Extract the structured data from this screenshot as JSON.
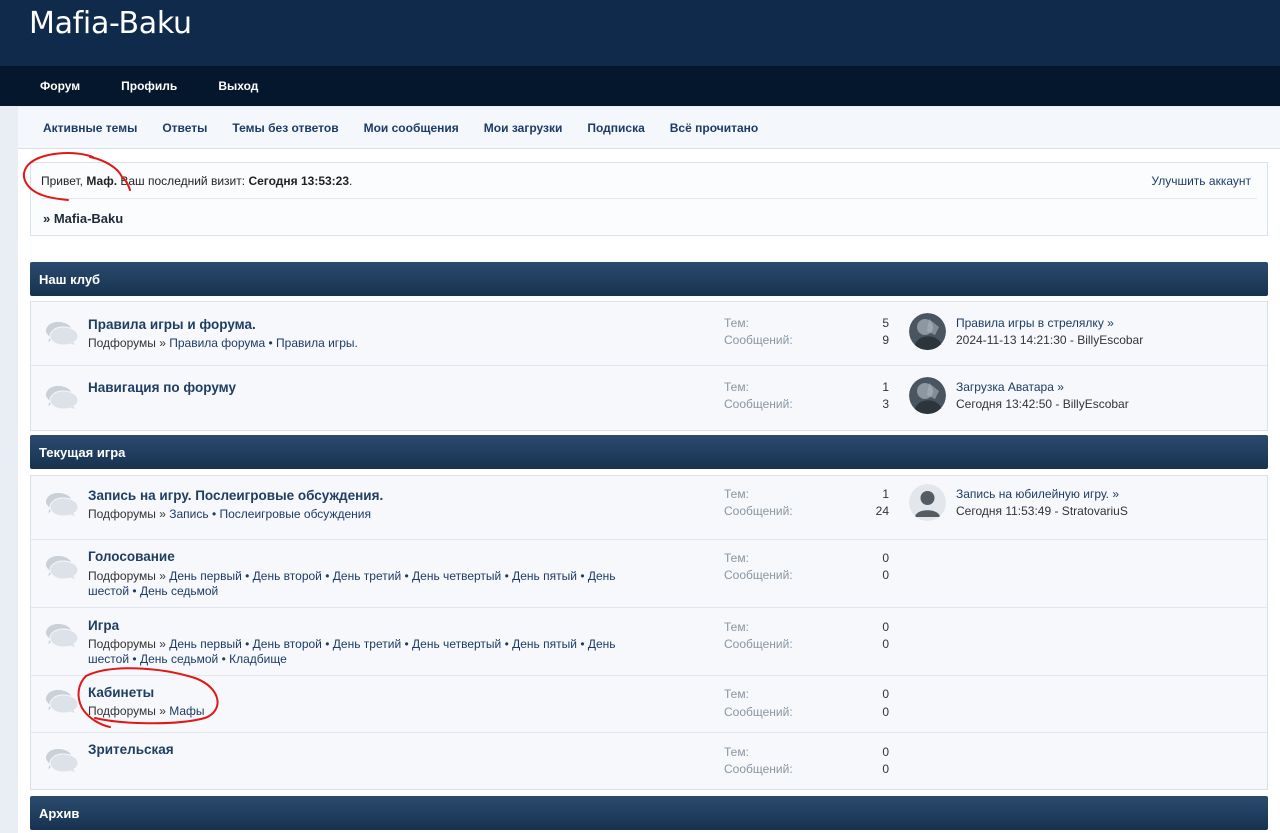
{
  "site": {
    "title": "Mafia-Baku"
  },
  "main_nav": [
    {
      "label": "Форум"
    },
    {
      "label": "Профиль"
    },
    {
      "label": "Выход"
    }
  ],
  "sub_nav": [
    {
      "label": "Активные темы"
    },
    {
      "label": "Ответы"
    },
    {
      "label": "Темы без ответов"
    },
    {
      "label": "Мои сообщения"
    },
    {
      "label": "Мои загрузки"
    },
    {
      "label": "Подписка"
    },
    {
      "label": "Всё прочитано"
    }
  ],
  "welcome": {
    "greeting": "Привет,",
    "username": "Маф.",
    "last_visit_label": "Ваш последний визит:",
    "last_visit_value": "Сегодня 13:53:23",
    "last_visit_suffix": ".",
    "upgrade_link": "Улучшить аккаунт",
    "breadcrumb": "» Mafia-Baku"
  },
  "labels": {
    "topics": "Тем:",
    "posts": "Сообщений:",
    "subforums": "Подфорумы »",
    "bullet": "•"
  },
  "categories": [
    {
      "title": "Наш клуб",
      "forums": [
        {
          "title": "Правила игры и форума.",
          "subforums": [
            "Правила форума",
            "Правила игры."
          ],
          "topics": "5",
          "posts": "9",
          "last_post": {
            "title": "Правила игры в стрелялку »",
            "meta": "2024-11-13 14:21:30 - BillyEscobar",
            "avatar": "photo-avatar"
          }
        },
        {
          "title": "Навигация по форуму",
          "subforums": [],
          "topics": "1",
          "posts": "3",
          "last_post": {
            "title": "Загрузка Аватара »",
            "meta": "Сегодня 13:42:50 - BillyEscobar",
            "avatar": "photo-avatar"
          }
        }
      ]
    },
    {
      "title": "Текущая игра",
      "forums": [
        {
          "title": "Запись на игру. Послеигровые обсуждения.",
          "subforums": [
            "Запись",
            "Послеигровые обсуждения"
          ],
          "topics": "1",
          "posts": "24",
          "last_post": {
            "title": "Запись на юбилейную игру. »",
            "meta": "Сегодня 11:53:49 - StratovariuS",
            "avatar": "default-avatar"
          }
        },
        {
          "title": "Голосование",
          "subforums": [
            "День первый",
            "День второй",
            "День третий",
            "День четвертый",
            "День пятый",
            "День шестой",
            "День седьмой"
          ],
          "topics": "0",
          "posts": "0",
          "last_post": null
        },
        {
          "title": "Игра",
          "subforums": [
            "День первый",
            "День второй",
            "День третий",
            "День четвертый",
            "День пятый",
            "День шестой",
            "День седьмой",
            "Кладбище"
          ],
          "topics": "0",
          "posts": "0",
          "last_post": null
        },
        {
          "title": "Кабинеты",
          "subforums": [
            "Мафы"
          ],
          "topics": "0",
          "posts": "0",
          "last_post": null
        },
        {
          "title": "Зрительская",
          "subforums": [],
          "topics": "0",
          "posts": "0",
          "last_post": null
        }
      ]
    },
    {
      "title": "Архив",
      "forums": []
    }
  ],
  "colors": {
    "header_bg": "#0f2a4a",
    "nav_bg": "#04172d",
    "category_header": "#1f3b5c",
    "link": "#1c3c66",
    "annotation_red": "#e01818"
  }
}
